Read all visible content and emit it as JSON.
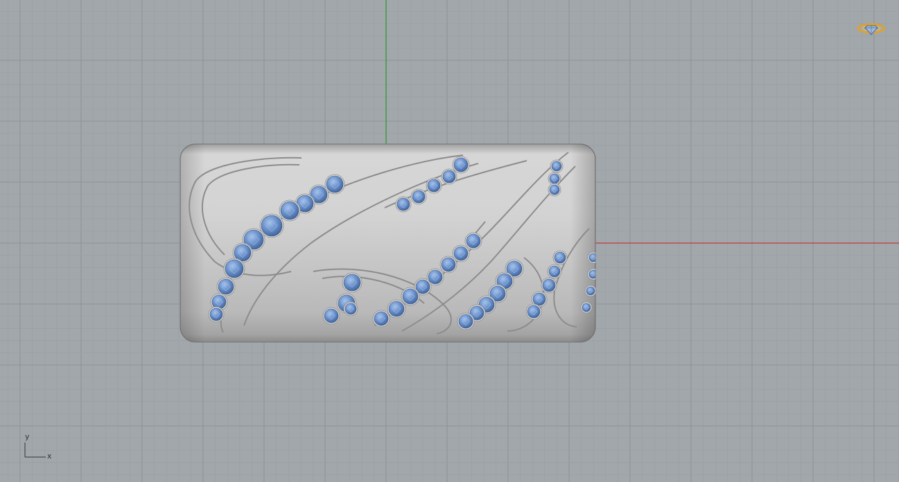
{
  "viewport": {
    "background": "#a2a7ab",
    "grid_minor_color": "#9aa0a4",
    "grid_major_color": "#8d9397",
    "x_axis_color": "#c23a3a",
    "y_axis_color": "#2e9a3a"
  },
  "axis_triad": {
    "x_label": "x",
    "y_label": "y"
  },
  "model": {
    "icon": "ring-render-icon",
    "metal_color": "#c8c8c8",
    "stone_color": "#5f86c2"
  },
  "corner_icon": {
    "icon": "diamond-ring-logo-icon",
    "color": "#e6a21a"
  }
}
